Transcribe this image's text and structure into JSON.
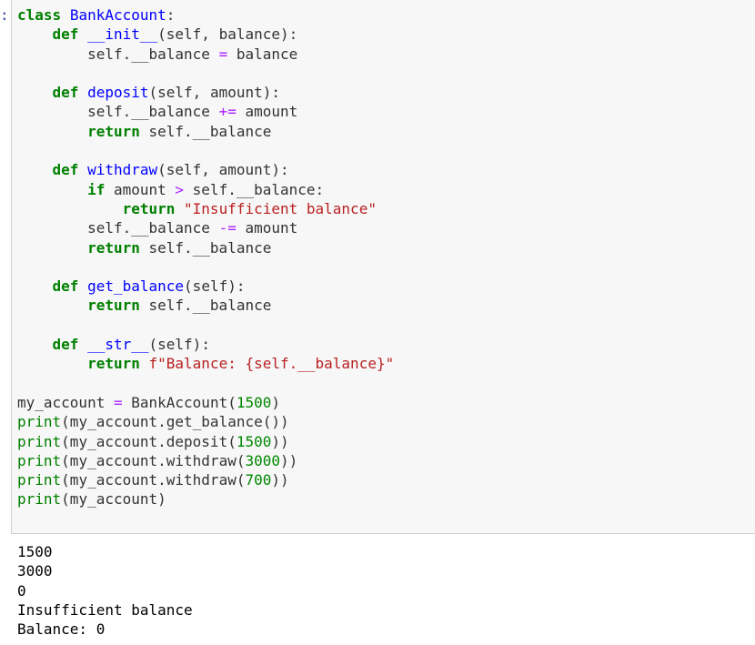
{
  "notebook": {
    "prompt_marker": ":",
    "code_lines": [
      "class BankAccount:",
      "    def __init__(self, balance):",
      "        self.__balance = balance",
      "",
      "    def deposit(self, amount):",
      "        self.__balance += amount",
      "        return self.__balance",
      "",
      "    def withdraw(self, amount):",
      "        if amount > self.__balance:",
      "            return \"Insufficient balance\"",
      "        self.__balance -= amount",
      "        return self.__balance",
      "",
      "    def get_balance(self):",
      "        return self.__balance",
      "",
      "    def __str__(self):",
      "        return f\"Balance: {self.__balance}\"",
      "",
      "my_account = BankAccount(1500)",
      "print(my_account.get_balance())",
      "print(my_account.deposit(1500))",
      "print(my_account.withdraw(3000))",
      "print(my_account.withdraw(700))",
      "print(my_account)"
    ],
    "output_lines": [
      "1500",
      "3000",
      "0",
      "Insufficient balance",
      "Balance: 0"
    ]
  },
  "colors": {
    "keyword": "#008000",
    "definition_name": "#0000ff",
    "operator": "#aa22ff",
    "string": "#ba2121",
    "cell_background": "#f7f7f7",
    "cell_border": "#cfcfcf"
  }
}
